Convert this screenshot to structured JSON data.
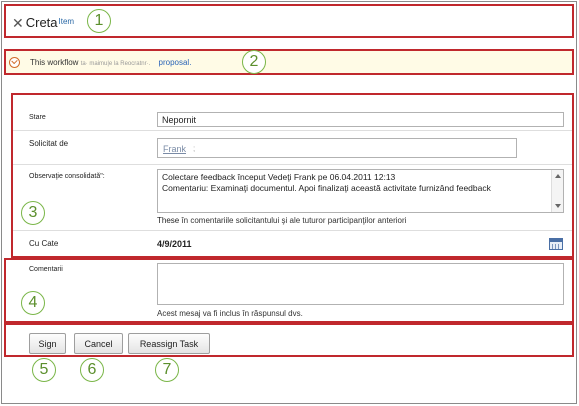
{
  "header": {
    "title": "Creta",
    "title_suffix": "Item",
    "close_icon": "close-icon"
  },
  "info_bar": {
    "icon": "workflow-info-icon",
    "text": "This workflow",
    "faint_text": "ta· maimu|e la Reocratnr·.",
    "link": "proposal."
  },
  "fields": {
    "status": {
      "label": "Stare",
      "value": "Nepornit"
    },
    "requested_by": {
      "label": "Solicitat de",
      "value": "Frank",
      "separator": ";"
    },
    "consolidated_notes": {
      "label": "Observaţie consolidată\":",
      "lines": [
        "Colectare feedback început Vedeţi Frank pe 06.04.2011 12:13",
        "Comentariu: Examinaţi documentul. Apoi finalizaţi această activitate furnizând feedback"
      ],
      "note_lead": "These",
      "note": " în comentariile solicitantului şi ale tuturor participanţilor anteriori"
    },
    "due_date": {
      "label": "Cu Cate",
      "value": "4/9/2011"
    }
  },
  "comments": {
    "label": "Comentarii",
    "value": "",
    "note": "Acest mesaj va fi inclus în răspunsul dvs."
  },
  "buttons": {
    "sign": "Sign",
    "cancel": "Cancel",
    "reassign": "Reassign Task"
  },
  "callouts": [
    "1",
    "2",
    "3",
    "4",
    "5",
    "6",
    "7"
  ],
  "colors": {
    "highlight_border": "#c0282d",
    "callout_green": "#7ab648",
    "info_background": "#fffbe6",
    "link_blue": "#2a64b8"
  }
}
